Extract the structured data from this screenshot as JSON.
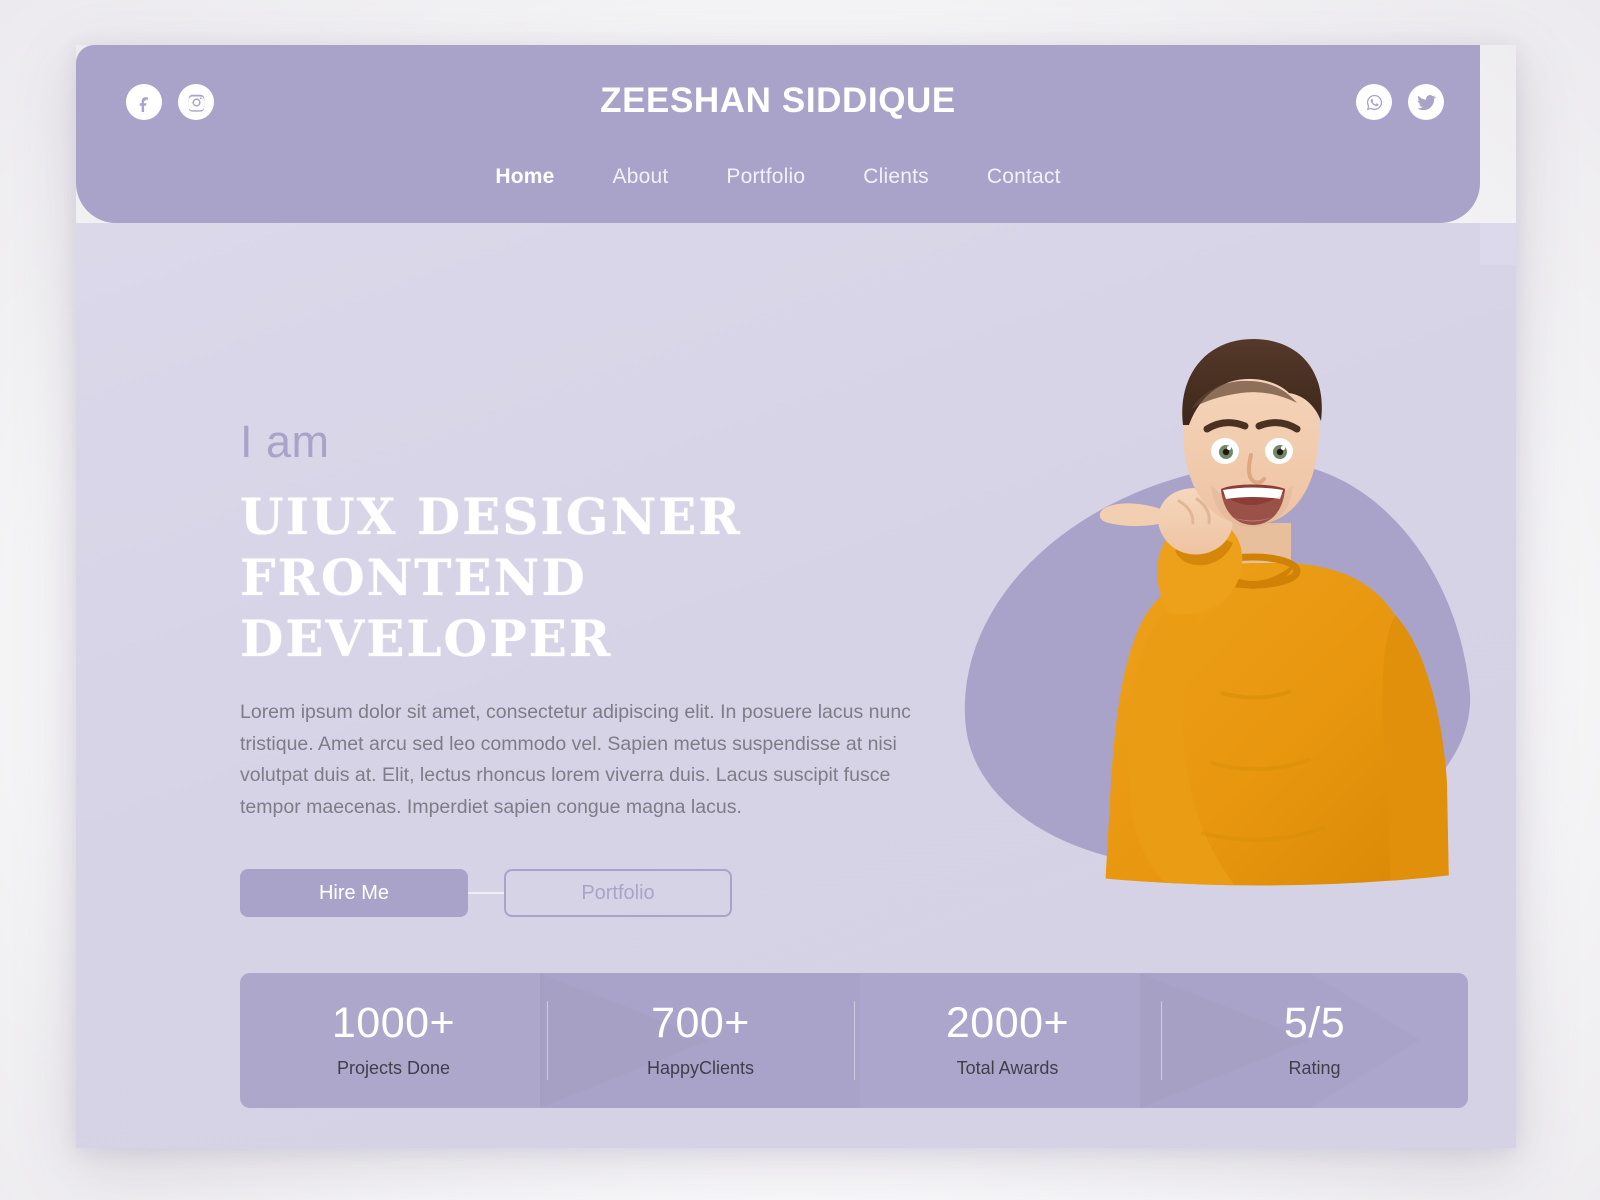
{
  "header": {
    "brand_title": "ZEESHAN SIDDIQUE",
    "social_left": [
      {
        "name": "facebook-icon",
        "label": "Facebook"
      },
      {
        "name": "instagram-icon",
        "label": "Instagram"
      }
    ],
    "social_right": [
      {
        "name": "whatsapp-icon",
        "label": "WhatsApp"
      },
      {
        "name": "twitter-icon",
        "label": "Twitter"
      }
    ],
    "nav": [
      {
        "label": "Home",
        "active": true
      },
      {
        "label": "About",
        "active": false
      },
      {
        "label": "Portfolio",
        "active": false
      },
      {
        "label": "Clients",
        "active": false
      },
      {
        "label": "Contact",
        "active": false
      }
    ]
  },
  "hero": {
    "eyebrow": "I am",
    "title_line1": "UIUX DESIGNER",
    "title_line2": "FRONTEND DEVELOPER",
    "paragraph": "Lorem ipsum dolor sit amet, consectetur adipiscing elit. In posuere lacus nunc tristique. Amet arcu sed leo commodo vel. Sapien metus suspendisse at nisi volutpat duis at. Elit, lectus rhoncus lorem viverra duis. Lacus suscipit fusce tempor maecenas. Imperdiet sapien congue magna lacus.",
    "primary_button": "Hire Me",
    "secondary_button": "Portfolio",
    "photo_alt": "smiling-man-pointing-thumb"
  },
  "stats": [
    {
      "value": "1000+",
      "label": "Projects Done"
    },
    {
      "value": "700+",
      "label": "HappyClients"
    },
    {
      "value": "2000+",
      "label": "Total Awards"
    },
    {
      "value": "5/5",
      "label": "Rating"
    }
  ],
  "colors": {
    "brand_purple": "#a9a3ca",
    "hero_background": "#d7d3e7",
    "accent_orange": "#e8970f",
    "text_muted": "#7e7c86",
    "white": "#ffffff"
  }
}
